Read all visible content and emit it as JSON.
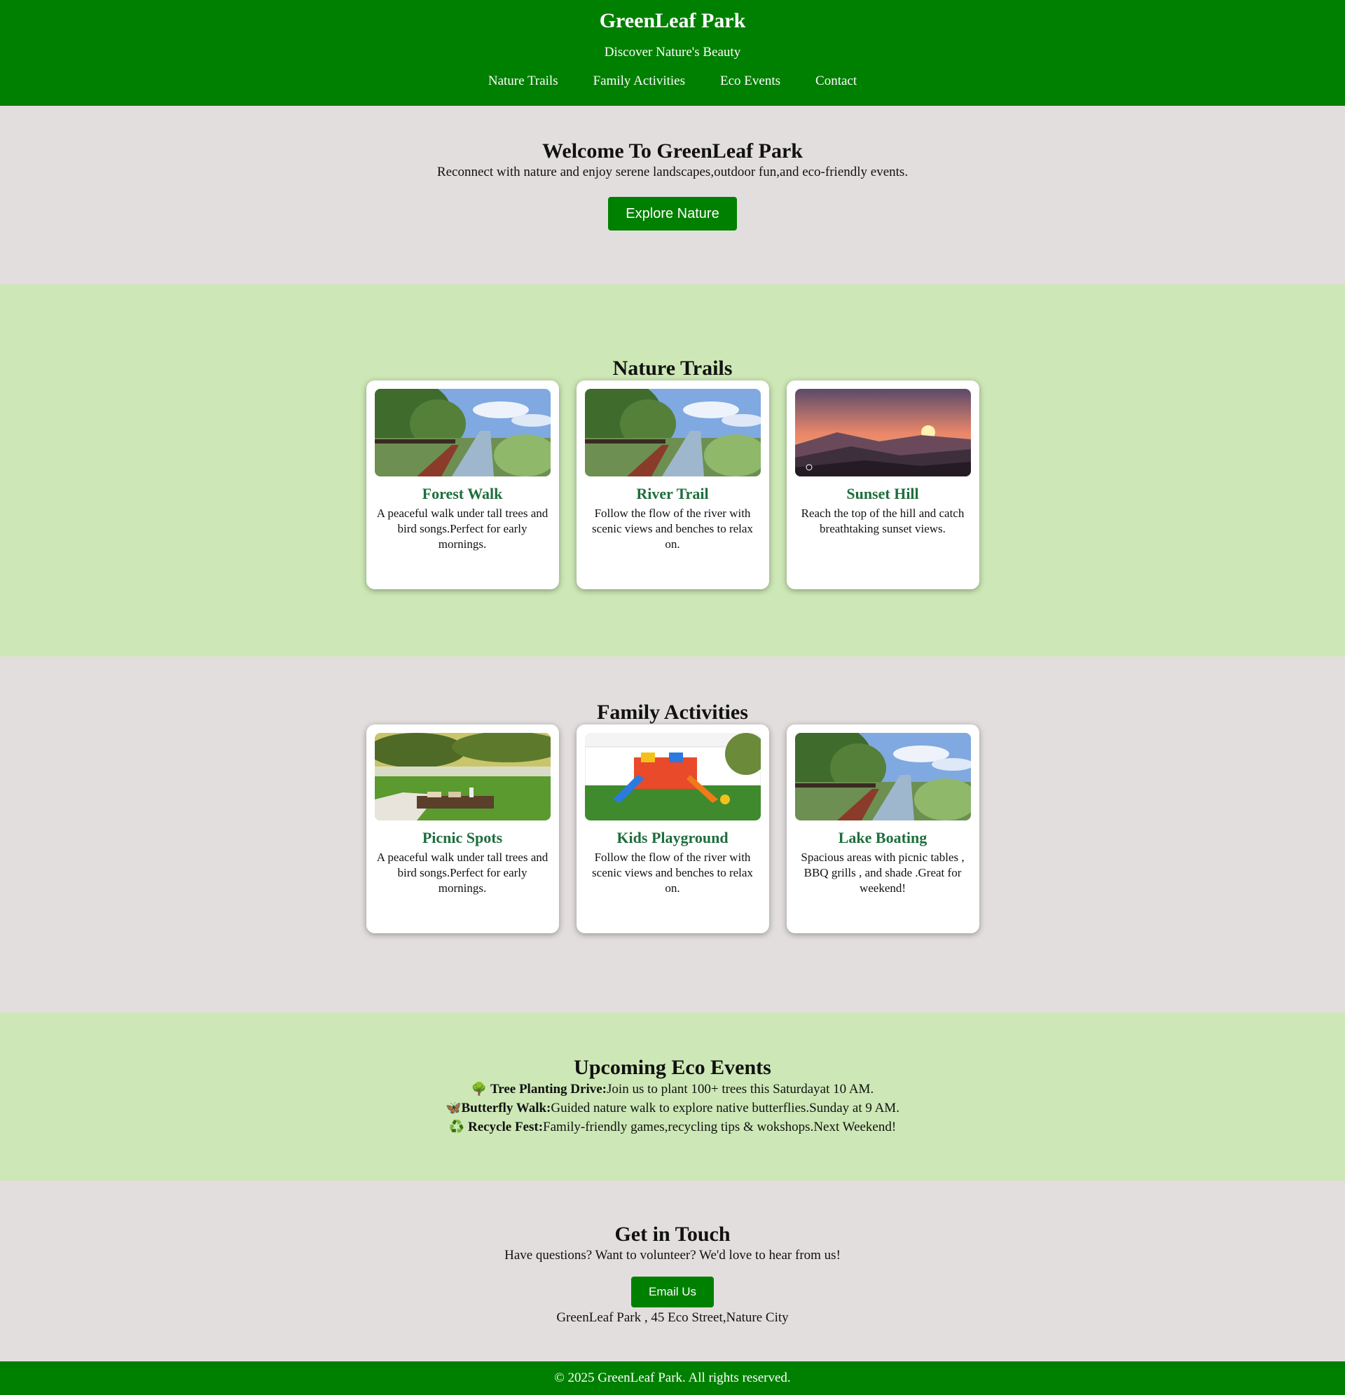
{
  "header": {
    "title": "GreenLeaf Park",
    "tagline": "Discover Nature's Beauty",
    "nav": [
      "Nature Trails",
      "Family Activities",
      "Eco Events",
      "Contact"
    ]
  },
  "hero": {
    "title": "Welcome To GreenLeaf Park",
    "subtitle": "Reconnect with nature and enjoy serene landscapes,outdoor fun,and eco-friendly events.",
    "button": "Explore Nature"
  },
  "trails": {
    "title": "Nature Trails",
    "cards": [
      {
        "title": "Forest Walk",
        "desc": "A peaceful walk under tall trees and bird songs.Perfect for early mornings."
      },
      {
        "title": "River Trail",
        "desc": "Follow the flow of the river with scenic views and benches to relax on."
      },
      {
        "title": "Sunset Hill",
        "desc": "Reach the top of the hill and catch breathtaking sunset views."
      }
    ]
  },
  "family": {
    "title": "Family Activities",
    "cards": [
      {
        "title": "Picnic Spots",
        "desc": "A peaceful walk under tall trees and bird songs.Perfect for early mornings."
      },
      {
        "title": "Kids Playground",
        "desc": "Follow the flow of the river with scenic views and benches to relax on."
      },
      {
        "title": "Lake Boating",
        "desc": "Spacious areas with picnic tables , BBQ grills , and shade .Great for weekend!"
      }
    ]
  },
  "events": {
    "title": "Upcoming Eco Events",
    "items": [
      {
        "icon": "🌳",
        "name": "Tree Planting Drive:",
        "text": "Join us to plant 100+ trees this Saturdayat 10 AM."
      },
      {
        "icon": "🦋",
        "name": "Butterfly Walk:",
        "text": "Guided nature walk to explore native butterflies.Sunday at 9 AM."
      },
      {
        "icon": "♻️",
        "name": "Recycle Fest:",
        "text": "Family-friendly games,recycling tips & wokshops.Next Weekend!"
      }
    ]
  },
  "contact": {
    "title": "Get in Touch",
    "subtitle": "Have questions? Want to volunteer? We'd love to hear from us!",
    "button": "Email Us",
    "address": "GreenLeaf Park , 45 Eco Street,Nature City"
  },
  "footer": {
    "text": "© 2025 GreenLeaf Park. All rights reserved."
  },
  "colors": {
    "brand_green": "#008000",
    "light_green_band": "#cde8b6",
    "gray_band": "#e3dede",
    "card_title": "#1f6e3e"
  }
}
